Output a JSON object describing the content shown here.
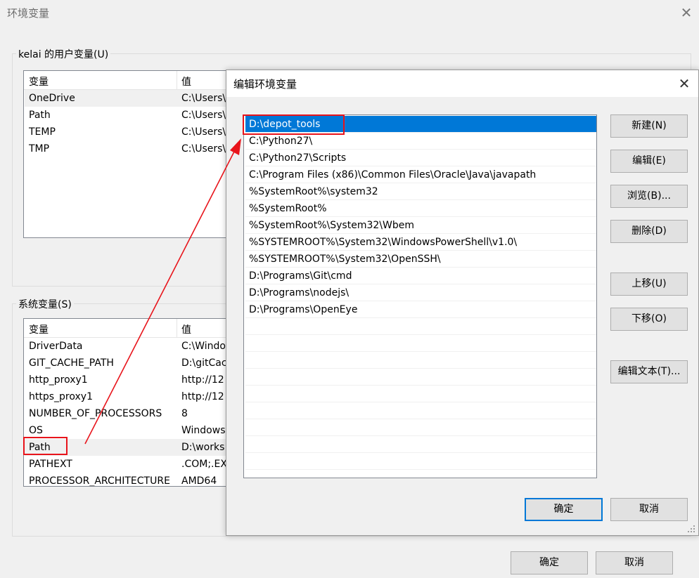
{
  "outer": {
    "title": "环境变量",
    "user_group_label": "kelai 的用户变量(U)",
    "system_group_label": "系统变量(S)",
    "col_var": "变量",
    "col_val": "值",
    "user_vars": [
      {
        "name": "OneDrive",
        "value": "C:\\Users\\"
      },
      {
        "name": "Path",
        "value": "C:\\Users\\"
      },
      {
        "name": "TEMP",
        "value": "C:\\Users\\"
      },
      {
        "name": "TMP",
        "value": "C:\\Users\\"
      }
    ],
    "system_vars": [
      {
        "name": "DriverData",
        "value": "C:\\Windo"
      },
      {
        "name": "GIT_CACHE_PATH",
        "value": "D:\\gitCac"
      },
      {
        "name": "http_proxy1",
        "value": "http://12"
      },
      {
        "name": "https_proxy1",
        "value": "http://12"
      },
      {
        "name": "NUMBER_OF_PROCESSORS",
        "value": "8"
      },
      {
        "name": "OS",
        "value": "Windows"
      },
      {
        "name": "Path",
        "value": "D:\\works"
      },
      {
        "name": "PATHEXT",
        "value": ".COM;.EX"
      },
      {
        "name": "PROCESSOR_ARCHITECTURE",
        "value": "AMD64"
      }
    ],
    "ok_label": "确定",
    "cancel_label": "取消"
  },
  "dialog": {
    "title": "编辑环境变量",
    "paths": [
      "D:\\depot_tools",
      "C:\\Python27\\",
      "C:\\Python27\\Scripts",
      "C:\\Program Files (x86)\\Common Files\\Oracle\\Java\\javapath",
      "%SystemRoot%\\system32",
      "%SystemRoot%",
      "%SystemRoot%\\System32\\Wbem",
      "%SYSTEMROOT%\\System32\\WindowsPowerShell\\v1.0\\",
      "%SYSTEMROOT%\\System32\\OpenSSH\\",
      "D:\\Programs\\Git\\cmd",
      "D:\\Programs\\nodejs\\",
      "D:\\Programs\\OpenEye"
    ],
    "buttons": {
      "new": "新建(N)",
      "edit": "编辑(E)",
      "browse": "浏览(B)...",
      "delete": "删除(D)",
      "move_up": "上移(U)",
      "move_down": "下移(O)",
      "edit_text": "编辑文本(T)..."
    },
    "ok_label": "确定",
    "cancel_label": "取消"
  },
  "colors": {
    "selection": "#0078d7",
    "annotation": "#e8141b"
  },
  "icons": {
    "close": "close-icon"
  }
}
